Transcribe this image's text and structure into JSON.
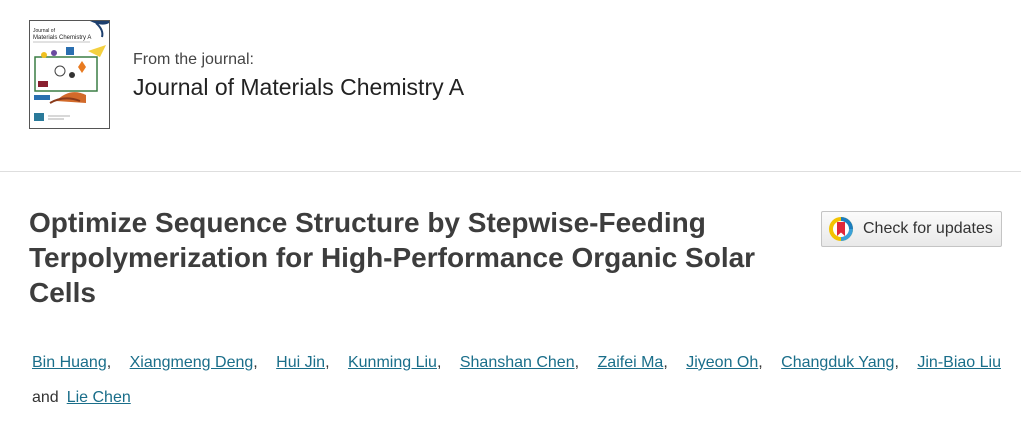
{
  "journal": {
    "from_label": "From the journal:",
    "name": "Journal of Materials Chemistry A",
    "cover_title_line1": "Journal of",
    "cover_title_line2": "Materials Chemistry A"
  },
  "article": {
    "title": "Optimize Sequence Structure by Stepwise-Feeding Terpolymerization for High-Performance Organic Solar Cells"
  },
  "check_updates": {
    "label": "Check for updates"
  },
  "authors": {
    "names": [
      "Bin Huang",
      "Xiangmeng Deng",
      "Hui Jin",
      "Kunming Liu",
      "Shanshan Chen",
      "Zaifei Ma",
      "Jiyeon Oh",
      "Changduk Yang",
      "Jin-Biao Liu",
      "Lie Chen"
    ],
    "separator": ",",
    "conjunction": "and"
  },
  "colors": {
    "link": "#1a6e8a",
    "title": "#3d3d3d",
    "divider": "#dedede"
  }
}
